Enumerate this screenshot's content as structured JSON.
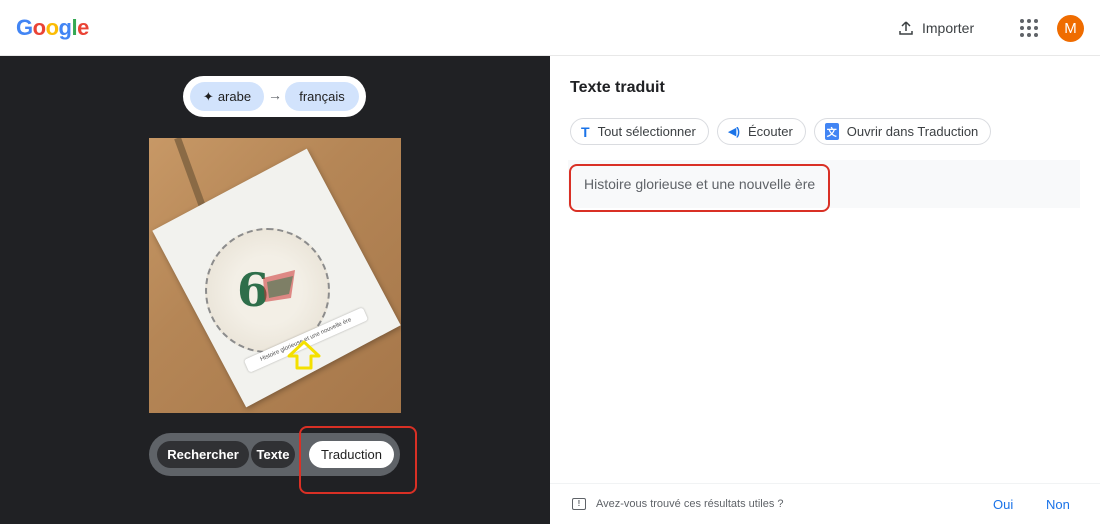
{
  "header": {
    "logo_letters": [
      {
        "ch": "G",
        "color": "#4285F4"
      },
      {
        "ch": "o",
        "color": "#EA4335"
      },
      {
        "ch": "o",
        "color": "#FBBC05"
      },
      {
        "ch": "g",
        "color": "#4285F4"
      },
      {
        "ch": "l",
        "color": "#34A853"
      },
      {
        "ch": "e",
        "color": "#EA4335"
      }
    ],
    "upload_label": "Importer",
    "upload_icon": "upload-icon",
    "apps_icon": "apps-grid-icon",
    "avatar_letter": "M",
    "avatar_color": "#ef6c00"
  },
  "left": {
    "source_lang": "arabe",
    "source_icon": "sparkle-icon",
    "arrow": "→",
    "target_lang": "français",
    "image_overlay_text": "Histoire glorieuse et une nouvelle ère",
    "modes": [
      {
        "label": "Rechercher",
        "active": false
      },
      {
        "label": "Texte",
        "active": false
      },
      {
        "label": "Traduction",
        "active": true
      }
    ]
  },
  "right": {
    "title": "Texte traduit",
    "actions": [
      {
        "label": "Tout sélectionner",
        "icon": "text-select-icon",
        "glyph": "T"
      },
      {
        "label": "Écouter",
        "icon": "speaker-icon",
        "glyph": "🔊"
      },
      {
        "label": "Ouvrir dans Traduction",
        "icon": "translate-icon",
        "glyph": "文"
      }
    ],
    "translated_text": "Histoire glorieuse et une nouvelle ère",
    "feedback": {
      "question": "Avez-vous trouvé ces résultats utiles ?",
      "yes": "Oui",
      "no": "Non"
    }
  },
  "colors": {
    "highlight": "#d93025",
    "accent": "#1a73e8",
    "chip": "#d2e3fc"
  }
}
